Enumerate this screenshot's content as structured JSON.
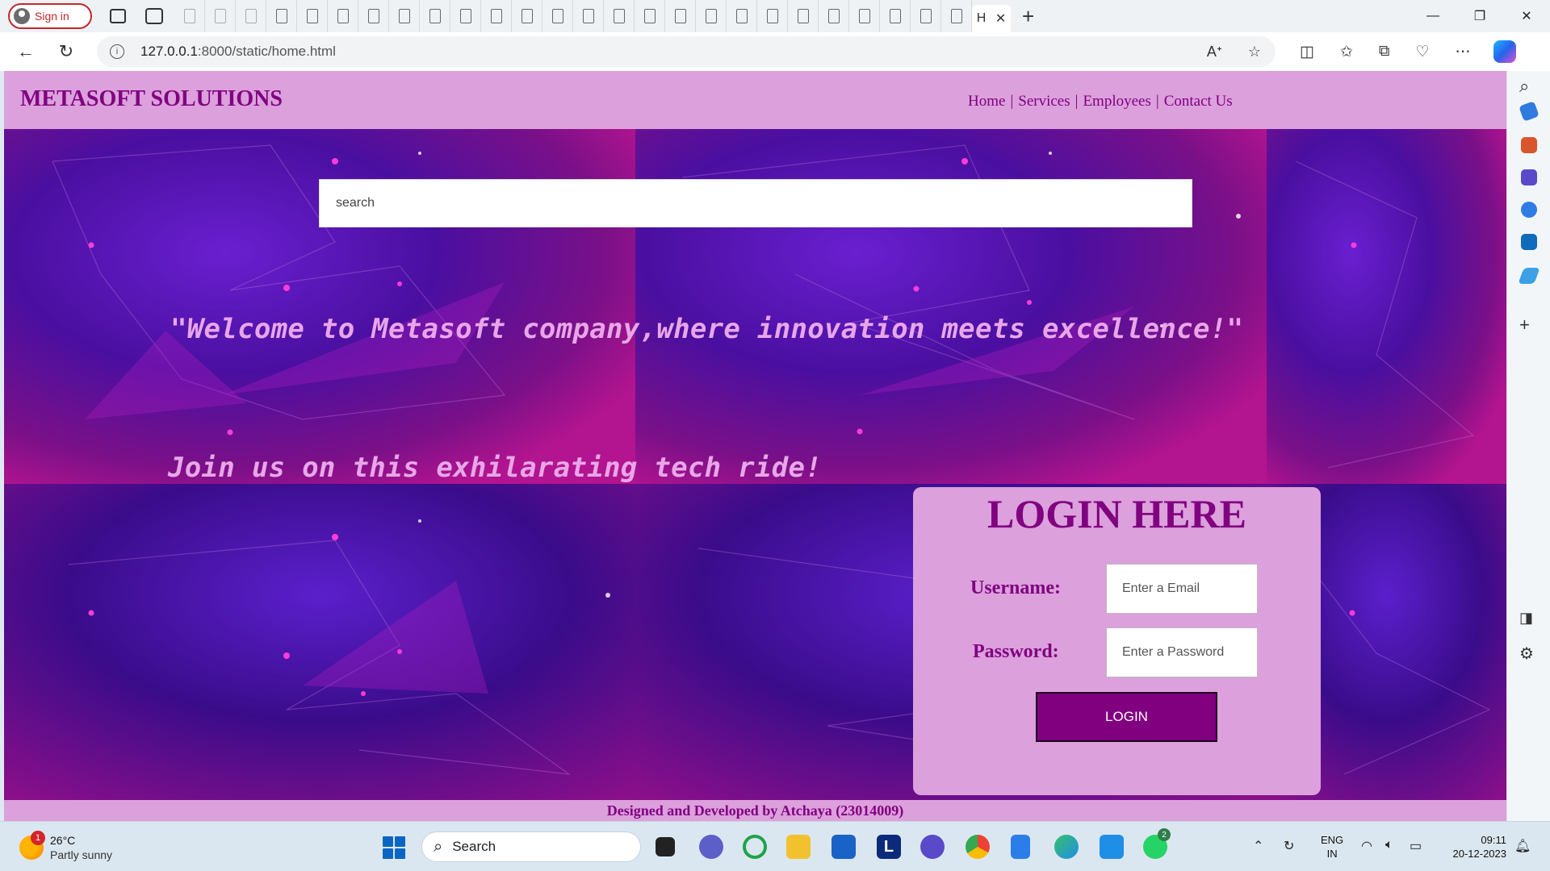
{
  "browser": {
    "signin_label": "Sign in",
    "url_host": "127.0.0.1",
    "url_path": ":8000/static/home.html",
    "active_tab_label": "H",
    "tab_close": "✕",
    "new_tab": "+",
    "window_minimize": "—",
    "window_restore": "❐",
    "window_close": "✕"
  },
  "site": {
    "brand": "METASOFT SOLUTIONS",
    "nav": {
      "home": "Home",
      "services": "Services",
      "employees": "Employees",
      "contact": "Contact Us",
      "separator": "|"
    },
    "search_placeholder": "search",
    "hero_line1": "\"Welcome to Metasoft company,where innovation meets excellence!\"",
    "hero_line2": "Join us on this exhilarating tech ride!",
    "login": {
      "title": "LOGIN HERE",
      "username_label": "Username:",
      "username_placeholder": "Enter a Email",
      "password_label": "Password:",
      "password_placeholder": "Enter a Password",
      "button": "LOGIN"
    },
    "footer": "Designed and Developed by Atchaya (23014009)",
    "colors": {
      "accent": "#800080",
      "panel": "#dca0dc"
    }
  },
  "taskbar": {
    "weather_temp": "26°C",
    "weather_desc": "Partly sunny",
    "weather_badge": "1",
    "search_label": "Search",
    "lang_line1": "ENG",
    "lang_line2": "IN",
    "time": "09:11",
    "date": "20-12-2023",
    "whatsapp_badge": "2"
  }
}
